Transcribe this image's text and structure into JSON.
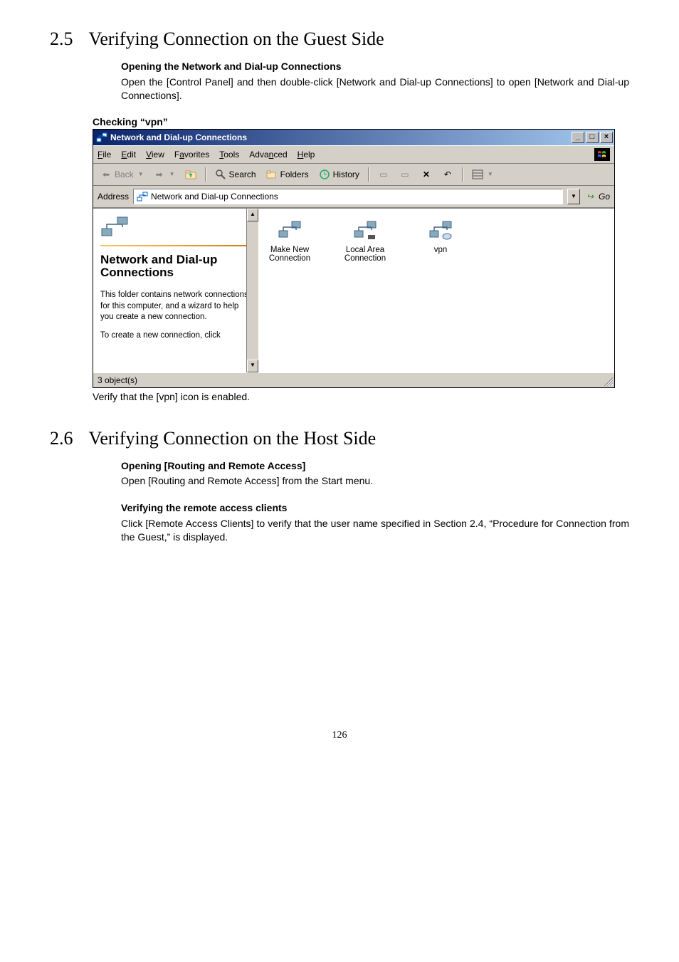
{
  "sections": {
    "s25": {
      "num": "2.5",
      "title": "Verifying Connection on the Guest Side",
      "sub1_title": "Opening the Network and Dial-up Connections",
      "sub1_body": "Open the [Control Panel] and then double-click [Network and Dial-up Connections] to open [Network and Dial-up Connections].",
      "check_head": "Checking “vpn”",
      "caption": "Verify that the [vpn] icon is enabled."
    },
    "s26": {
      "num": "2.6",
      "title": "Verifying Connection on the Host Side",
      "sub1_title": "Opening [Routing and Remote Access]",
      "sub1_body": "Open [Routing and Remote Access] from the Start menu.",
      "sub2_title": "Verifying the remote access clients",
      "sub2_body": "Click [Remote Access Clients] to verify that the user name specified in Section 2.4, “Procedure for Connection from the Guest,” is displayed."
    }
  },
  "window": {
    "title": "Network and Dial-up Connections",
    "menus": {
      "file": "File",
      "edit": "Edit",
      "view": "View",
      "favorites": "Favorites",
      "tools": "Tools",
      "advanced": "Advanced",
      "help": "Help"
    },
    "toolbar": {
      "back": "Back",
      "search": "Search",
      "folders": "Folders",
      "history": "History"
    },
    "address": {
      "label": "Address",
      "value": "Network and Dial-up Connections",
      "go": "Go"
    },
    "left": {
      "title": "Network and Dial-up Connections",
      "desc": "This folder contains network connections for this computer, and a wizard to help you create a new connection.",
      "hint": "To create a new connection, click"
    },
    "items": [
      {
        "label": "Make New\nConnection"
      },
      {
        "label": "Local Area\nConnection"
      },
      {
        "label": "vpn"
      }
    ],
    "status": "3 object(s)"
  },
  "page_number": "126"
}
